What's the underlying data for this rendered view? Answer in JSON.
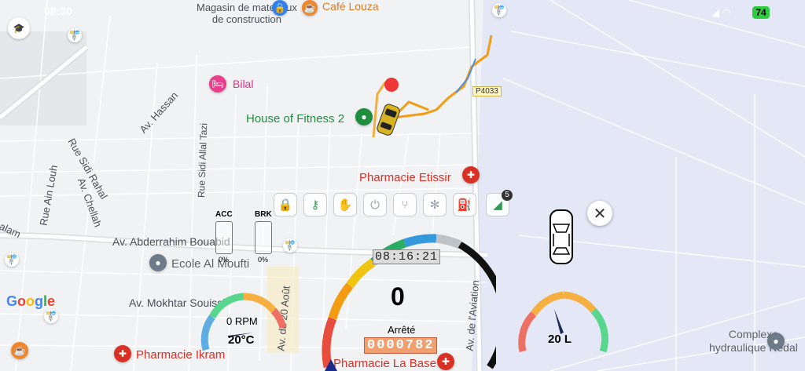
{
  "status_bar": {
    "time": "08:30",
    "battery": "74"
  },
  "map": {
    "poi": [
      {
        "id": "magasin",
        "line1": "Magasin de materiaux",
        "line2": "de construction"
      },
      {
        "id": "cafe",
        "label": "Café Louza"
      },
      {
        "id": "bilal",
        "label": "Bilal"
      },
      {
        "id": "fitness",
        "label": "House of Fitness 2"
      },
      {
        "id": "etissir",
        "label": "Pharmacie Etissir"
      },
      {
        "id": "ecole",
        "label": "Ecole Al Moufti"
      },
      {
        "id": "ikram",
        "label": "Pharmacie Ikram"
      },
      {
        "id": "labase",
        "label": "Pharmacie La Base"
      },
      {
        "id": "complexe",
        "line1": "Complexe",
        "line2": "hydraulique Redal"
      }
    ],
    "streets": {
      "hassan": "Av. Hassan",
      "sidi_rahal": "Rue Sidi Rahal",
      "ain_louh": "Rue Ain Louh",
      "chellah": "Av. Chellah",
      "allal_tazi": "Rue Sidi Allal Tazi",
      "abderrahim": "Av. Abderrahim Bouabid",
      "mokhtar": "Av. Mokhtar Souissi",
      "vingt_aout": "Av. du 20 Août",
      "aviation": "Av. de l'Aviation",
      "salam": "alam"
    },
    "road_badge": "P4033",
    "google": "Google"
  },
  "indicators": {
    "signal_count": "5",
    "icons": [
      "lock-icon",
      "key-icon",
      "hand-icon",
      "power-icon",
      "seat-icon",
      "snowflake-icon",
      "fuel-pump-icon",
      "signal-icon"
    ]
  },
  "pedals": {
    "acc": {
      "label": "ACC",
      "value": "0%"
    },
    "brk": {
      "label": "BRK",
      "value": "0%"
    }
  },
  "rpm_gauge": {
    "rpm": "0 RPM",
    "temp": "20°C"
  },
  "speed_gauge": {
    "speed": "0",
    "status": "Arrêté",
    "clock": "08:16:21",
    "odometer": "0000782"
  },
  "fuel_gauge": {
    "value": "20 L"
  },
  "colors": {
    "route": "#f39c12",
    "route_blue": "#4a90e2",
    "water": "#e3e8f6",
    "road": "#ffffff"
  }
}
